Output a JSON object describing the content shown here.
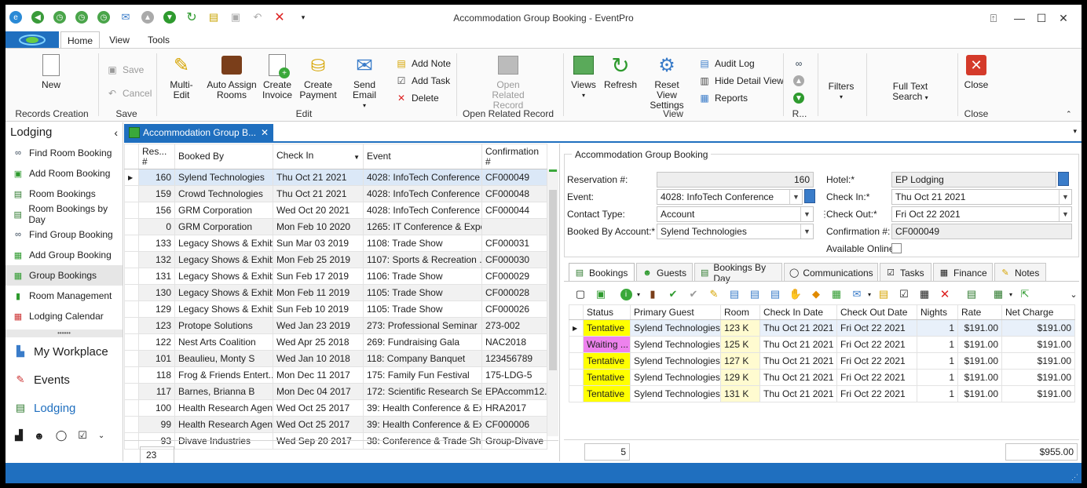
{
  "window": {
    "title": "Accommodation Group Booking - EventPro"
  },
  "menu": {
    "tabs": [
      "Home",
      "View",
      "Tools"
    ]
  },
  "ribbon": {
    "new": "New",
    "save": "Save",
    "cancel": "Cancel",
    "multi_edit": "Multi-Edit",
    "auto_assign": "Auto Assign",
    "auto_assign2": "Rooms",
    "create_invoice": "Create",
    "create_invoice2": "Invoice",
    "create_payment": "Create",
    "create_payment2": "Payment",
    "send_email": "Send Email",
    "add_note": "Add Note",
    "add_task": "Add Task",
    "delete": "Delete",
    "open_related": "Open Related",
    "open_related2": "Record",
    "views": "Views",
    "refresh": "Refresh",
    "reset_view": "Reset View",
    "reset_view2": "Settings",
    "audit_log": "Audit Log",
    "hide_detail": "Hide Detail View",
    "reports": "Reports",
    "filters": "Filters",
    "full_text": "Full Text",
    "full_text2": "Search",
    "close": "Close",
    "groups": {
      "records_creation": "Records Creation",
      "save": "Save",
      "edit": "Edit",
      "open_related": "Open Related Record",
      "view": "View",
      "r": "R...",
      "close": "Close"
    }
  },
  "leftnav": {
    "header": "Lodging",
    "items": [
      {
        "label": "Find Room Booking",
        "icon": "binoculars-icon"
      },
      {
        "label": "Add Room Booking",
        "icon": "add-booking-icon"
      },
      {
        "label": "Room Bookings",
        "icon": "grid-icon"
      },
      {
        "label": "Room Bookings by Day",
        "icon": "grid-icon"
      },
      {
        "label": "Find Group Booking",
        "icon": "binoculars-icon"
      },
      {
        "label": "Add Group Booking",
        "icon": "add-group-icon"
      },
      {
        "label": "Group Bookings",
        "icon": "group-grid-icon"
      },
      {
        "label": "Room Management",
        "icon": "traffic-light-icon"
      },
      {
        "label": "Lodging Calendar",
        "icon": "calendar-icon"
      }
    ],
    "dots": "••••••",
    "big": [
      "My Workplace",
      "Events",
      "Lodging"
    ]
  },
  "doctab": {
    "label": "Accommodation Group B..."
  },
  "grid": {
    "headers": [
      "Res...\n#",
      "Booked By",
      "Check In",
      "Event",
      "Confirmation\n#"
    ],
    "rows": [
      [
        "160",
        "Sylend Technologies",
        "Thu Oct 21 2021",
        "4028: InfoTech Conference",
        "CF000049"
      ],
      [
        "159",
        "Crowd Technologies",
        "Thu Oct 21 2021",
        "4028: InfoTech Conference",
        "CF000048"
      ],
      [
        "156",
        "GRM Corporation",
        "Wed Oct 20 2021",
        "4028: InfoTech Conference",
        "CF000044"
      ],
      [
        "0",
        "GRM Corporation",
        "Mon Feb 10 2020",
        "1265: IT Conference & Expo",
        ""
      ],
      [
        "133",
        "Legacy Shows & Exhib...",
        "Sun Mar 03 2019",
        "1108: Trade Show",
        "CF000031"
      ],
      [
        "132",
        "Legacy Shows & Exhib...",
        "Mon Feb 25 2019",
        "1107: Sports & Recreation ...",
        "CF000030"
      ],
      [
        "131",
        "Legacy Shows & Exhib...",
        "Sun Feb 17 2019",
        "1106: Trade Show",
        "CF000029"
      ],
      [
        "130",
        "Legacy Shows & Exhib...",
        "Mon Feb 11 2019",
        "1105: Trade Show",
        "CF000028"
      ],
      [
        "129",
        "Legacy Shows & Exhib...",
        "Sun Feb 10 2019",
        "1105: Trade Show",
        "CF000026"
      ],
      [
        "123",
        "Protope Solutions",
        "Wed Jan 23 2019",
        "273: Professional Seminar",
        "273-002"
      ],
      [
        "122",
        "Nest Arts Coalition",
        "Wed Apr 25 2018",
        "269: Fundraising Gala",
        "NAC2018"
      ],
      [
        "101",
        "Beaulieu, Monty S",
        "Wed Jan 10 2018",
        "118: Company Banquet",
        "123456789"
      ],
      [
        "118",
        "Frog & Friends Entert...",
        "Mon Dec 11 2017",
        "175: Family Fun Festival",
        "175-LDG-5"
      ],
      [
        "117",
        "Barnes, Brianna B",
        "Mon Dec 04 2017",
        "172: Scientific Research Se...",
        "EPAccomm12..."
      ],
      [
        "100",
        "Health Research Agen...",
        "Wed Oct 25 2017",
        "39: Health Conference & Ex...",
        "HRA2017"
      ],
      [
        "99",
        "Health Research Agen...",
        "Wed Oct 25 2017",
        "39: Health Conference & Ex...",
        "CF000006"
      ],
      [
        "93",
        "Divave Industries",
        "Wed Sep 20 2017",
        "38: Conference & Trade Sh...",
        "Group-Divave"
      ]
    ],
    "count": "23"
  },
  "detail": {
    "group_title": "Accommodation Group Booking",
    "reservation_label": "Reservation #:",
    "reservation_value": "160",
    "event_label": "Event:",
    "event_value": "4028: InfoTech Conference",
    "contact_type_label": "Contact Type:",
    "contact_type_value": "Account",
    "booked_by_label": "Booked By Account:*",
    "booked_by_value": "Sylend Technologies",
    "hotel_label": "Hotel:*",
    "hotel_value": "EP Lodging",
    "checkin_label": "Check In:*",
    "checkin_value": "Thu Oct 21 2021",
    "checkout_label": "Check Out:*",
    "checkout_value": "Fri Oct 22 2021",
    "confirmation_label": "Confirmation #:",
    "confirmation_value": "CF000049",
    "available_online_label": "Available Online"
  },
  "subtabs": [
    "Bookings",
    "Guests",
    "Bookings By Day",
    "Communications",
    "Tasks",
    "Finance",
    "Notes"
  ],
  "bookings": {
    "headers": [
      "Status",
      "Primary Guest",
      "Room",
      "Check In Date",
      "Check Out Date",
      "Nights",
      "Rate",
      "Net Charge"
    ],
    "rows": [
      [
        "Tentative",
        "Sylend Technologies",
        "123 K",
        "Thu Oct 21 2021",
        "Fri Oct 22 2021",
        "1",
        "$191.00",
        "$191.00"
      ],
      [
        "Waiting ...",
        "Sylend Technologies",
        "125 K",
        "Thu Oct 21 2021",
        "Fri Oct 22 2021",
        "1",
        "$191.00",
        "$191.00"
      ],
      [
        "Tentative",
        "Sylend Technologies",
        "127 K",
        "Thu Oct 21 2021",
        "Fri Oct 22 2021",
        "1",
        "$191.00",
        "$191.00"
      ],
      [
        "Tentative",
        "Sylend Technologies",
        "129 K",
        "Thu Oct 21 2021",
        "Fri Oct 22 2021",
        "1",
        "$191.00",
        "$191.00"
      ],
      [
        "Tentative",
        "Sylend Technologies",
        "131 K",
        "Thu Oct 21 2021",
        "Fri Oct 22 2021",
        "1",
        "$191.00",
        "$191.00"
      ]
    ],
    "count": "5",
    "total": "$955.00"
  },
  "colors": {
    "accent": "#1f6fbf",
    "tentative": "#ffff00",
    "waiting": "#ee82ee"
  }
}
